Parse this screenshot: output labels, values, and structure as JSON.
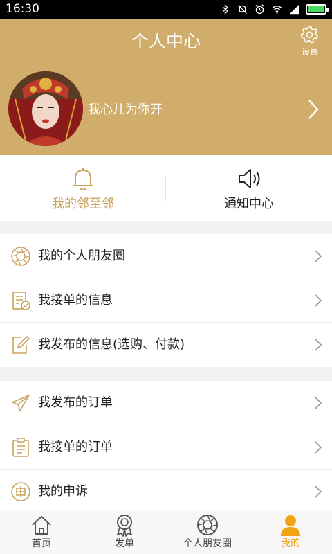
{
  "status_bar": {
    "time": "16:30"
  },
  "header": {
    "title": "个人中心",
    "settings_label": "设置"
  },
  "profile": {
    "username": "我心儿为你开"
  },
  "quick_tabs": [
    {
      "label": "我的邻至邻",
      "icon": "bell-icon"
    },
    {
      "label": "通知中心",
      "icon": "speaker-icon"
    }
  ],
  "menu_group_1": [
    {
      "label": "我的个人朋友圈",
      "icon": "aperture-icon"
    },
    {
      "label": "我接单的信息",
      "icon": "document-check-icon"
    },
    {
      "label": "我发布的信息(选购、付款)",
      "icon": "edit-icon"
    }
  ],
  "menu_group_2": [
    {
      "label": "我发布的订单",
      "icon": "paper-plane-icon"
    },
    {
      "label": "我接单的订单",
      "icon": "clipboard-icon"
    },
    {
      "label": "我的申诉",
      "icon": "appeal-icon"
    }
  ],
  "bottom_nav": [
    {
      "label": "首页",
      "icon": "home-icon"
    },
    {
      "label": "发单",
      "icon": "medal-icon"
    },
    {
      "label": "个人朋友圈",
      "icon": "aperture-icon"
    },
    {
      "label": "我的",
      "icon": "person-icon",
      "active": true
    }
  ],
  "colors": {
    "accent": "#d1ad6b",
    "gold_text": "#c9a25d",
    "nav_active": "#f0a415"
  }
}
